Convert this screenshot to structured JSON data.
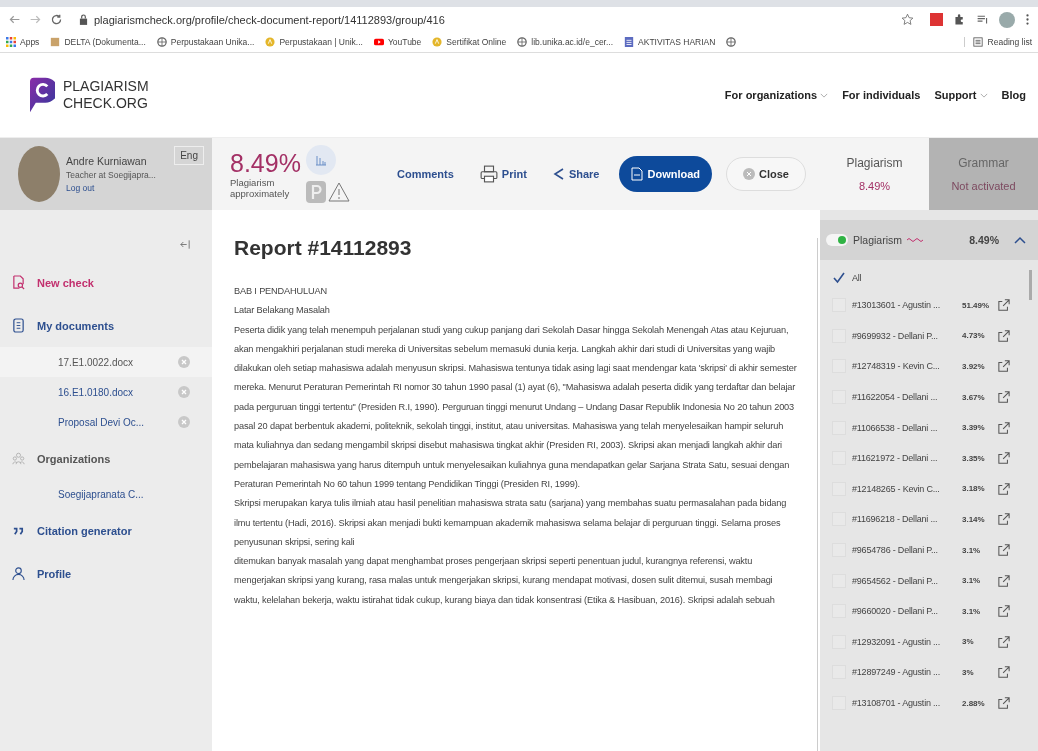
{
  "browser": {
    "url": "plagiarismcheck.org/profile/check-document-report/14112893/group/416",
    "bookmarks": [
      {
        "label": "Apps",
        "kind": "apps"
      },
      {
        "label": "DELTA (Dokumenta...",
        "kind": "page"
      },
      {
        "label": "Perpustakaan Unika...",
        "kind": "globe"
      },
      {
        "label": "Perpustakaan | Unik...",
        "kind": "badge"
      },
      {
        "label": "YouTube",
        "kind": "video"
      },
      {
        "label": "Sertifikat Online",
        "kind": "badge"
      },
      {
        "label": "lib.unika.ac.id/e_cer...",
        "kind": "globe"
      },
      {
        "label": "AKTIVITAS HARIAN",
        "kind": "sheet"
      },
      {
        "kind": "globe"
      }
    ],
    "reading_list": "Reading list"
  },
  "header": {
    "logo_lines": [
      "PLAGIARISM",
      "CHECK.ORG"
    ],
    "nav": [
      {
        "label": "For organizations",
        "dropdown": true
      },
      {
        "label": "For individuals",
        "dropdown": false
      },
      {
        "label": "Support",
        "dropdown": true
      },
      {
        "label": "Blog",
        "dropdown": false
      }
    ]
  },
  "profile": {
    "name": "Andre Kurniawan",
    "role": "Teacher at Soegijapra...",
    "logout": "Log out",
    "language": "Eng"
  },
  "sidebar": {
    "items": [
      {
        "label": "New check",
        "kind": "new"
      },
      {
        "label": "My documents",
        "kind": "docs",
        "children": [
          {
            "label": "17.E1.0022.docx",
            "selected": true
          },
          {
            "label": "16.E1.0180.docx",
            "selected": false
          },
          {
            "label": "Proposal Devi Oc...",
            "selected": false
          }
        ]
      },
      {
        "label": "Organizations",
        "kind": "orgs",
        "children": [
          {
            "label": "Soegijapranata C...",
            "selected": false
          }
        ]
      },
      {
        "label": "Citation generator",
        "kind": "cite"
      },
      {
        "label": "Profile",
        "kind": "profile"
      }
    ]
  },
  "toolbar": {
    "score": "8.49%",
    "score_label": "Plagiarism approximately",
    "actions": [
      {
        "label": "Comments",
        "kind": "comments"
      },
      {
        "label": "Print",
        "kind": "print"
      },
      {
        "label": "Share",
        "kind": "share"
      },
      {
        "label": "Download",
        "kind": "download"
      },
      {
        "label": "Close",
        "kind": "close"
      }
    ]
  },
  "report": {
    "title": "Report #14112893",
    "paragraphs": [
      "BAB I PENDAHULUAN",
      "Latar Belakang Masalah",
      "Peserta didik yang telah menempuh perjalanan studi yang cukup panjang dari Sekolah Dasar hingga Sekolah Menengah Atas atau Kejuruan, akan mengakhiri perjalanan studi mereka di Universitas sebelum memasuki dunia kerja. Langkah akhir dari studi di Universitas yang wajib dilakukan oleh setiap mahasiswa adalah menyusun skripsi. Mahasiswa tentunya tidak asing lagi saat mendengar kata 'skripsi' di akhir semester mereka. Menurut Peraturan Pemerintah RI nomor 30 tahun 1990 pasal (1) ayat (6), \"Mahasiswa adalah peserta didik yang terdaftar dan belajar pada perguruan tinggi tertentu\" (Presiden R.I, 1990). Perguruan tinggi menurut Undang – Undang Dasar Republik Indonesia No 20 tahun 2003 pasal 20 dapat berbentuk akademi, politeknik, sekolah tinggi, institut, atau universitas. Mahasiswa yang telah menyelesaikan hampir seluruh mata kuliahnya dan sedang mengambil skripsi disebut mahasiswa tingkat akhir (Presiden RI, 2003). Skripsi akan menjadi langkah akhir dari pembelajaran mahasiswa yang harus ditempuh untuk menyelesaikan kuliahnya guna mendapatkan gelar Sarjana Strata Satu, sesuai dengan Peraturan Pemerintah No 60 tahun 1999 tentang Pendidikan Tinggi (Presiden RI, 1999).",
      "Skripsi merupakan karya tulis ilmiah atau hasil penelitian mahasiswa strata satu (sarjana) yang membahas suatu permasalahan pada bidang ilmu tertentu (Hadi, 2016). Skripsi akan menjadi bukti kemampuan akademik mahasiswa selama belajar di perguruan tinggi. Selama proses penyusunan skripsi, sering kali",
      "ditemukan banyak masalah yang dapat menghambat proses pengerjaan skripsi seperti penentuan judul, kurangnya referensi, waktu mengerjakan skripsi yang kurang, rasa malas untuk mengerjakan skripsi, kurang mendapat motivasi, dosen sulit ditemui, susah membagi waktu, kelelahan bekerja, waktu istirahat tidak cukup, kurang biaya dan tidak konsentrasi (Etika & Hasibuan, 2016). Skripsi adalah sebuah"
    ]
  },
  "tabs": [
    {
      "label": "Plagiarism",
      "value": "8.49%",
      "selected": true
    },
    {
      "label": "Grammar",
      "value": "Not activated",
      "selected": false
    }
  ],
  "sources": {
    "header": {
      "label": "Plagiarism",
      "value": "8.49%",
      "on": true,
      "expanded": true
    },
    "all": {
      "label": "All",
      "checked": true
    },
    "items": [
      {
        "label": "#13013601 - Agustin ...",
        "percent": "51.49%",
        "checked": false
      },
      {
        "label": "#9699932 - Dellani P...",
        "percent": "4.73%",
        "checked": false
      },
      {
        "label": "#12748319 - Kevin C...",
        "percent": "3.92%",
        "checked": false
      },
      {
        "label": "#11622054 - Dellani ...",
        "percent": "3.67%",
        "checked": false
      },
      {
        "label": "#11066538 - Dellani ...",
        "percent": "3.39%",
        "checked": false
      },
      {
        "label": "#11621972 - Dellani ...",
        "percent": "3.35%",
        "checked": false
      },
      {
        "label": "#12148265 - Kevin C...",
        "percent": "3.18%",
        "checked": false
      },
      {
        "label": "#11696218 - Dellani ...",
        "percent": "3.14%",
        "checked": false
      },
      {
        "label": "#9654786 - Dellani P...",
        "percent": "3.1%",
        "checked": false
      },
      {
        "label": "#9654562 - Dellani P...",
        "percent": "3.1%",
        "checked": false
      },
      {
        "label": "#9660020 - Dellani P...",
        "percent": "3.1%",
        "checked": false
      },
      {
        "label": "#12932091 - Agustin ...",
        "percent": "3%",
        "checked": false
      },
      {
        "label": "#12897249 - Agustin ...",
        "percent": "3%",
        "checked": false
      },
      {
        "label": "#13108701 - Agustin ...",
        "percent": "2.88%",
        "checked": false
      }
    ]
  }
}
